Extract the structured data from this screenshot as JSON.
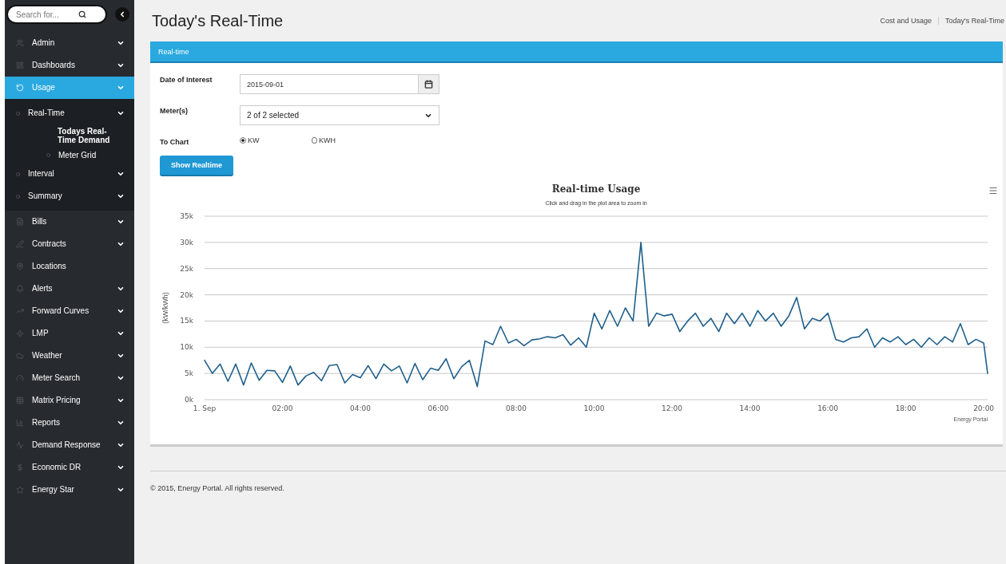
{
  "sidebar": {
    "search": {
      "placeholder": "Search for..."
    },
    "items": [
      {
        "label": "Admin",
        "selected": false,
        "expandable": true
      },
      {
        "label": "Dashboards",
        "selected": false,
        "expandable": true
      },
      {
        "label": "Usage",
        "selected": true,
        "expandable": true,
        "children": [
          {
            "label": "Real-Time",
            "selected": false,
            "expandable": true,
            "children": [
              {
                "label": "Todays Real-Time Demand",
                "selected": true
              },
              {
                "label": "Meter Grid",
                "selected": false
              }
            ]
          },
          {
            "label": "Interval",
            "selected": false,
            "expandable": true
          },
          {
            "label": "Summary",
            "selected": false,
            "expandable": true
          }
        ]
      },
      {
        "label": "Bills",
        "selected": false,
        "expandable": true
      },
      {
        "label": "Contracts",
        "selected": false,
        "expandable": true
      },
      {
        "label": "Locations",
        "selected": false,
        "expandable": false
      },
      {
        "label": "Alerts",
        "selected": false,
        "expandable": true
      },
      {
        "label": "Forward Curves",
        "selected": false,
        "expandable": true
      },
      {
        "label": "LMP",
        "selected": false,
        "expandable": true
      },
      {
        "label": "Weather",
        "selected": false,
        "expandable": true
      },
      {
        "label": "Meter Search",
        "selected": false,
        "expandable": true
      },
      {
        "label": "Matrix Pricing",
        "selected": false,
        "expandable": true
      },
      {
        "label": "Reports",
        "selected": false,
        "expandable": true
      },
      {
        "label": "Demand Response",
        "selected": false,
        "expandable": true
      },
      {
        "label": "Economic DR",
        "selected": false,
        "expandable": true
      },
      {
        "label": "Energy Star",
        "selected": false,
        "expandable": true
      }
    ]
  },
  "page": {
    "title": "Today's Real-Time",
    "breadcrumb": [
      "Cost and Usage",
      "Today's Real-Time"
    ]
  },
  "panel": {
    "title": "Real-time",
    "date_of_interest": {
      "label": "Date of Interest",
      "value": "2015-09-01"
    },
    "meters": {
      "label": "Meter(s)",
      "value": "2 of 2 selected"
    },
    "to_chart": {
      "label": "To Chart",
      "options": [
        {
          "label": "KW",
          "selected": true
        },
        {
          "label": "KWH",
          "selected": false
        }
      ]
    },
    "button": "Show Realtime",
    "chart": {
      "subtitle": "Click and drag in the plot area to zoom in",
      "credits": "Energy Portal",
      "chart_data": {
        "type": "line",
        "grid": true,
        "title": "Real-time Usage",
        "ylabel": "(kW/kWh)",
        "xlim": [
          0,
          20.1
        ],
        "ylim": [
          0,
          35000
        ],
        "xticks": [
          {
            "value": 0,
            "label": "1. Sep"
          },
          {
            "value": 2,
            "label": "02:00"
          },
          {
            "value": 4,
            "label": "04:00"
          },
          {
            "value": 6,
            "label": "06:00"
          },
          {
            "value": 8,
            "label": "08:00"
          },
          {
            "value": 10,
            "label": "10:00"
          },
          {
            "value": 12,
            "label": "12:00"
          },
          {
            "value": 14,
            "label": "14:00"
          },
          {
            "value": 16,
            "label": "16:00"
          },
          {
            "value": 18,
            "label": "18:00"
          },
          {
            "value": 20,
            "label": "20:00"
          }
        ],
        "yticks": [
          {
            "value": 0,
            "label": "0k"
          },
          {
            "value": 5000,
            "label": "5k"
          },
          {
            "value": 10000,
            "label": "10k"
          },
          {
            "value": 15000,
            "label": "15k"
          },
          {
            "value": 20000,
            "label": "20k"
          },
          {
            "value": 25000,
            "label": "25k"
          },
          {
            "value": 30000,
            "label": "30k"
          },
          {
            "value": 35000,
            "label": "35k"
          }
        ],
        "x": [
          0,
          0.2,
          0.4,
          0.6,
          0.8,
          1,
          1.2,
          1.4,
          1.6,
          1.8,
          2,
          2.2,
          2.4,
          2.6,
          2.8,
          3,
          3.2,
          3.4,
          3.6,
          3.8,
          4,
          4.2,
          4.4,
          4.6,
          4.8,
          5,
          5.2,
          5.4,
          5.6,
          5.8,
          6,
          6.2,
          6.4,
          6.6,
          6.8,
          7,
          7.2,
          7.4,
          7.6,
          7.8,
          8,
          8.2,
          8.4,
          8.6,
          8.8,
          9,
          9.2,
          9.4,
          9.6,
          9.8,
          10,
          10.2,
          10.4,
          10.6,
          10.8,
          11,
          11.2,
          11.4,
          11.6,
          11.8,
          12,
          12.2,
          12.4,
          12.6,
          12.8,
          13,
          13.2,
          13.4,
          13.6,
          13.8,
          14,
          14.2,
          14.4,
          14.6,
          14.8,
          15,
          15.2,
          15.4,
          15.6,
          15.8,
          16,
          16.2,
          16.4,
          16.6,
          16.8,
          17,
          17.2,
          17.4,
          17.6,
          17.8,
          18,
          18.2,
          18.4,
          18.6,
          18.8,
          19,
          19.2,
          19.4,
          19.6,
          19.8,
          20,
          20.1
        ],
        "series": [
          {
            "color": "#1f5f8b",
            "values": [
              7500,
              5000,
              6800,
              3500,
              6800,
              2800,
              7000,
              3700,
              5600,
              5500,
              3300,
              6400,
              2800,
              4500,
              5200,
              3600,
              6500,
              6700,
              3200,
              4800,
              4200,
              6500,
              4000,
              6800,
              5500,
              6400,
              3200,
              6900,
              3800,
              6000,
              5600,
              7800,
              4000,
              6300,
              7500,
              2500,
              11200,
              10500,
              14000,
              10800,
              11500,
              10300,
              11400,
              11600,
              12000,
              11800,
              12400,
              10400,
              11800,
              10000,
              16500,
              13500,
              17000,
              14000,
              17500,
              15000,
              30000,
              14000,
              16500,
              16000,
              16300,
              13000,
              15000,
              16500,
              14000,
              15500,
              13000,
              16500,
              14500,
              16500,
              14000,
              17000,
              15000,
              16500,
              14000,
              16000,
              19500,
              13500,
              15500,
              15000,
              16500,
              11500,
              11000,
              11800,
              12000,
              13500,
              10000,
              11800,
              11000,
              12000,
              10500,
              11500,
              10000,
              11800,
              10500,
              12000,
              11000,
              14500,
              10500,
              11500,
              10800,
              5000
            ]
          }
        ]
      }
    }
  },
  "footer": "© 2015, Energy Portal. All rights reserved."
}
